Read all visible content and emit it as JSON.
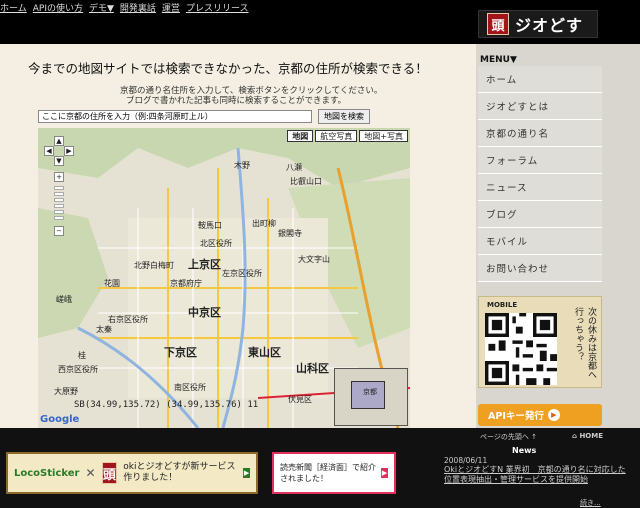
{
  "topnav": [
    "ホーム",
    "APIの使い方",
    "デモ▼",
    "開発裏話",
    "運営",
    "プレスリリース"
  ],
  "logo": {
    "seal": "頭",
    "text": "ジオどす"
  },
  "main": {
    "headline": "今までの地図サイトでは検索できなかった、京都の住所が検索できる！",
    "desc1": "京都の通り名住所を入力して、検索ボタンをクリックしてください。",
    "desc2": "ブログで書かれた記事も同時に検索することができます。",
    "search_placeholder": "ここに京都の住所を入力（例:四条河原町上ル）",
    "search_button": "地図を検索"
  },
  "map": {
    "types": [
      "地図",
      "航空写真",
      "地図+写真"
    ],
    "active_type": "地図",
    "labels": [
      "木野",
      "八瀬",
      "比叡山口",
      "大文字山",
      "上京区",
      "中京区",
      "下京区",
      "東山区",
      "山科区",
      "北区役所",
      "左京区役所",
      "京都府庁",
      "南区役所",
      "右京区役所",
      "西京区役所",
      "大原野",
      "花園",
      "太秦",
      "北野白梅町",
      "銀閣寺",
      "伏見区",
      "桂",
      "嵯峨",
      "鞍馬口",
      "出町柳"
    ],
    "coords": "SB(34.99,135.72) (34.99,135.76) 11",
    "inset_label": "京都",
    "google": "Google"
  },
  "sidebar": {
    "menu_title": "MENU▼",
    "items": [
      "ホーム",
      "ジオどすとは",
      "京都の通り名",
      "フォーラム",
      "ニュース",
      "ブログ",
      "モバイル",
      "お問い合わせ"
    ],
    "mobile_label": "MOBILE",
    "mobile_text": "次の休みは京都へ行っちゃう？",
    "api_button": "APIキー発行"
  },
  "footer": {
    "page_top": "ページの先頭へ ↑",
    "home": "⌂ HOME",
    "banner1": {
      "loco": "LocoSticker",
      "x": "✕",
      "seal": "頭",
      "text": "okiとジオどすが新サービス作りました！"
    },
    "banner2": {
      "text": "読売新聞［経済面］で紹介されました！"
    },
    "news_title": "News",
    "news_date": "2008/06/11",
    "news_body": "OkiとジオどすN 業界初　京都の通り名に対応した位置表現抽出・管理サービスを提供開始",
    "more": "続き..."
  },
  "colors": {
    "topbar": "#000000",
    "seal": "#a0161a",
    "api": "#f0a020",
    "footer": "#111111"
  }
}
